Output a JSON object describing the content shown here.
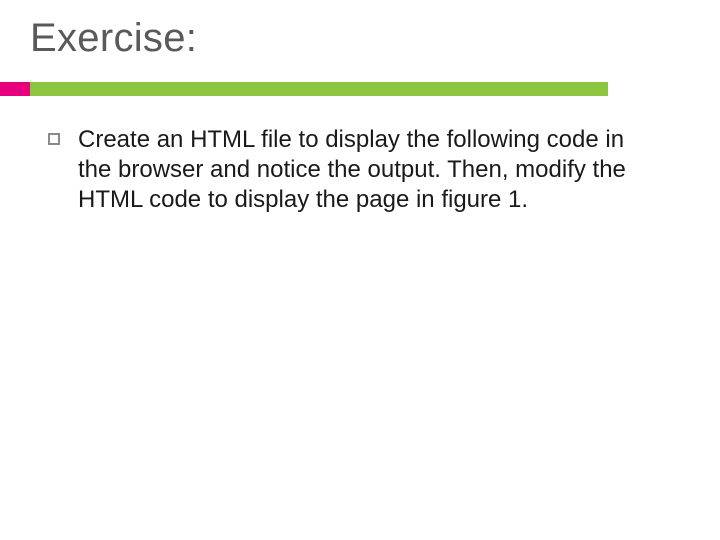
{
  "title": "Exercise:",
  "bullets": [
    "Create an HTML file to display the following code in the browser and notice the output. Then, modify the HTML code to display the page in figure 1."
  ],
  "colors": {
    "accent_pink": "#e6007e",
    "accent_green": "#8cc540",
    "title_color": "#595959"
  }
}
